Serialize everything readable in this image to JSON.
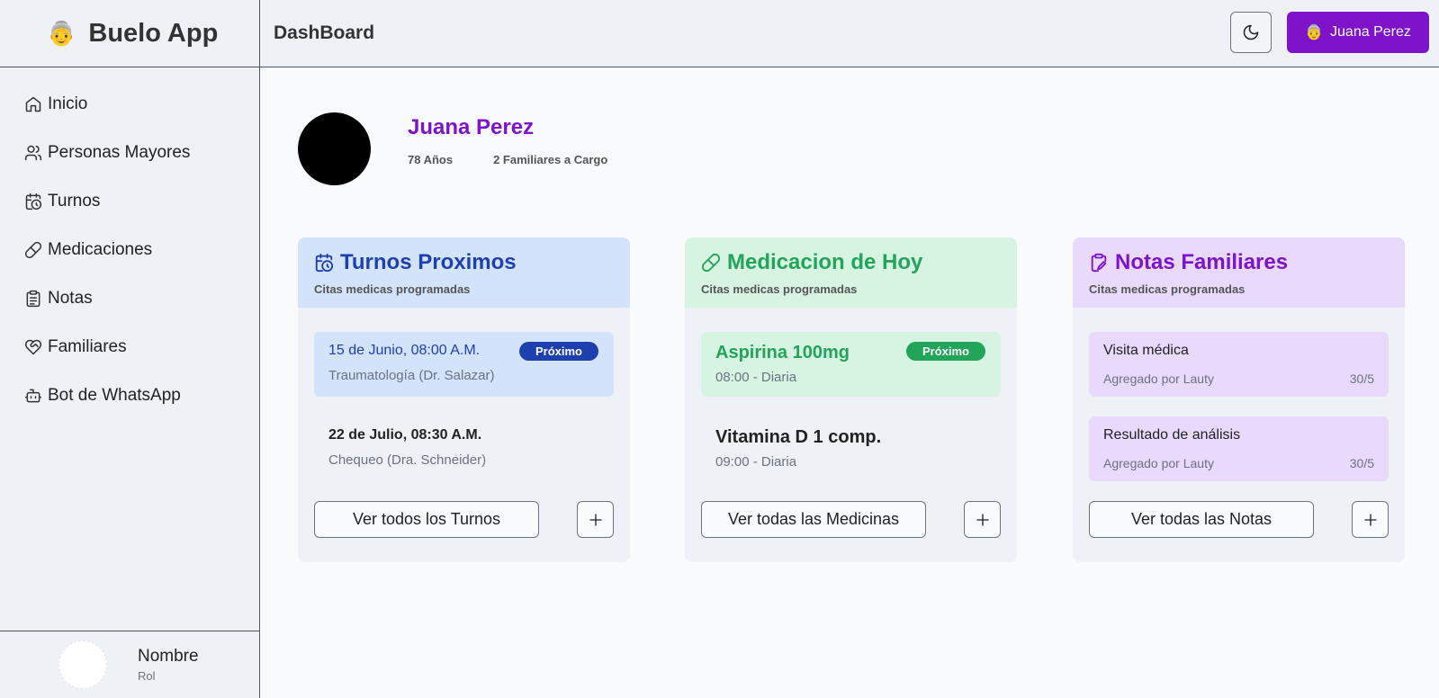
{
  "app": {
    "title": "Buelo App",
    "brand_emoji": "👵"
  },
  "sidebar": {
    "items": [
      {
        "label": "Inicio",
        "icon": "home-icon"
      },
      {
        "label": "Personas Mayores",
        "icon": "users-icon"
      },
      {
        "label": "Turnos",
        "icon": "calendar-clock-icon"
      },
      {
        "label": "Medicaciones",
        "icon": "pill-icon"
      },
      {
        "label": "Notas",
        "icon": "clipboard-icon"
      },
      {
        "label": "Familiares",
        "icon": "heart-handshake-icon"
      },
      {
        "label": "Bot de WhatsApp",
        "icon": "bot-icon"
      }
    ],
    "footer": {
      "name": "Nombre",
      "role": "Rol"
    }
  },
  "header": {
    "title": "DashBoard",
    "user_button": {
      "emoji": "👵",
      "label": "Juana Perez"
    }
  },
  "profile": {
    "name": "Juana Perez",
    "age": "78 Años",
    "family": "2 Familiares a Cargo"
  },
  "colors": {
    "accent": "#7e13c9",
    "turnos_head": "#d3e3fb",
    "turnos_text": "#1e40af",
    "med_head": "#d7f4e2",
    "med_text": "#22a55a",
    "notes_head": "#e9dafd",
    "notes_text": "#7e13c9"
  },
  "cards": {
    "turnos": {
      "title": "Turnos Proximos",
      "subtitle": "Citas medicas programadas",
      "items": [
        {
          "title": "15 de Junio, 08:00 A.M.",
          "sub": "Traumatología (Dr. Salazar)",
          "badge": "Próximo"
        },
        {
          "title": "22 de Julio, 08:30 A.M.",
          "sub": "Chequeo (Dra. Schneider)"
        }
      ],
      "view_all": "Ver todos los Turnos"
    },
    "medicacion": {
      "title": "Medicacion de Hoy",
      "subtitle": "Citas medicas programadas",
      "items": [
        {
          "title": "Aspirina 100mg",
          "sub": "08:00 - Diaria",
          "badge": "Próximo"
        },
        {
          "title": "Vitamina D 1 comp.",
          "sub": "09:00 - Diaria"
        }
      ],
      "view_all": "Ver todas las Medicinas"
    },
    "notas": {
      "title": "Notas Familiares",
      "subtitle": "Citas medicas programadas",
      "items": [
        {
          "title": "Visita médica",
          "author": "Agregado por Lauty",
          "date": "30/5"
        },
        {
          "title": "Resultado de análisis",
          "author": "Agregado por Lauty",
          "date": "30/5"
        }
      ],
      "view_all": "Ver todas las Notas"
    }
  }
}
